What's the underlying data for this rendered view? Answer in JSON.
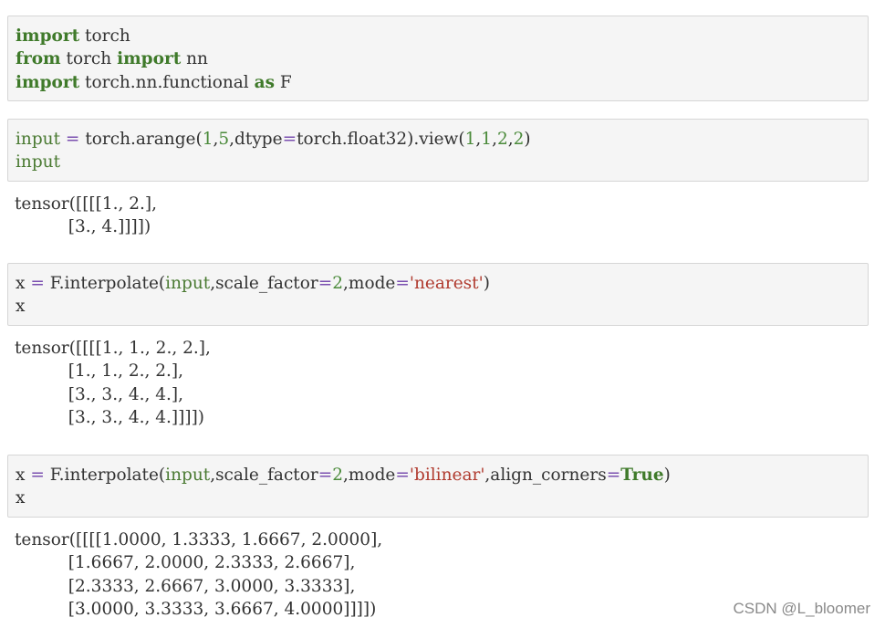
{
  "cells": [
    {
      "lines": [
        [
          "import",
          " torch"
        ],
        [
          "from",
          " torch ",
          "import",
          " nn"
        ],
        [
          "import",
          " torch.nn.functional ",
          "as",
          " F"
        ]
      ]
    },
    {
      "lines": [
        [
          "input",
          " ",
          "=",
          " torch.arange(",
          "1",
          ",",
          "5",
          ",dtype",
          "=",
          "torch.float32).view(",
          "1",
          ",",
          "1",
          ",",
          "2",
          ",",
          "2",
          ")"
        ],
        [
          "input"
        ]
      ],
      "output": "tensor([[[[1., 2.],\n          [3., 4.]]]])"
    },
    {
      "lines": [
        [
          "x ",
          "=",
          " F.interpolate(",
          "input",
          ",scale_factor",
          "=",
          "2",
          ",mode",
          "=",
          "'nearest'",
          ")"
        ],
        [
          "x"
        ]
      ],
      "output": "tensor([[[[1., 1., 2., 2.],\n          [1., 1., 2., 2.],\n          [3., 3., 4., 4.],\n          [3., 3., 4., 4.]]]])"
    },
    {
      "lines": [
        [
          "x ",
          "=",
          " F.interpolate(",
          "input",
          ",scale_factor",
          "=",
          "2",
          ",mode",
          "=",
          "'bilinear'",
          ",align_corners",
          "=",
          "True",
          ")"
        ],
        [
          "x"
        ]
      ],
      "output": "tensor([[[[1.0000, 1.3333, 1.6667, 2.0000],\n          [1.6667, 2.0000, 2.3333, 2.6667],\n          [2.3333, 2.6667, 3.0000, 3.3333],\n          [3.0000, 3.3333, 3.6667, 4.0000]]]])"
    }
  ],
  "watermark": "CSDN @L_bloomer",
  "colors": {
    "cell_background": "#f5f5f5",
    "keyword": "#3f7a2a",
    "string": "#b03a2e",
    "number": "#4a8a3a",
    "operator": "#7a4fb0"
  }
}
